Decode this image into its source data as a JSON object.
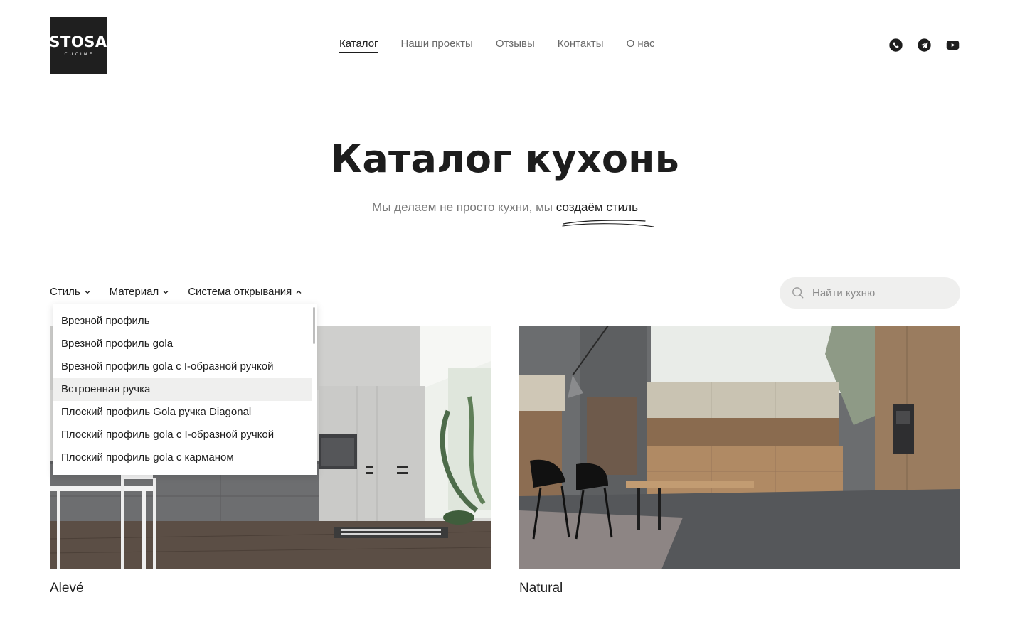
{
  "logo": {
    "main": "STOSA",
    "sub": "CUCINE"
  },
  "nav": {
    "items": [
      {
        "label": "Каталог",
        "active": true
      },
      {
        "label": "Наши проекты",
        "active": false
      },
      {
        "label": "Отзывы",
        "active": false
      },
      {
        "label": "Контакты",
        "active": false
      },
      {
        "label": "О нас",
        "active": false
      }
    ]
  },
  "social": {
    "icons": [
      "whatsapp-icon",
      "telegram-icon",
      "youtube-icon"
    ]
  },
  "hero": {
    "title": "Каталог кухонь",
    "subtitle_lead": "Мы делаем не просто кухни, мы ",
    "subtitle_accent": "создаём стиль"
  },
  "filters": {
    "style": "Стиль",
    "material": "Материал",
    "opening": "Система открывания"
  },
  "search": {
    "placeholder": "Найти кухню"
  },
  "dropdown": {
    "items": [
      "Врезной профиль",
      "Врезной профиль gola",
      "Врезной профиль gola с I-образной ручкой",
      "Встроенная ручка",
      "Плоский профиль Gola ручка Diagonal",
      "Плоский профиль gola с I-образной ручкой",
      "Плоский профиль gola с карманом"
    ],
    "highlighted_index": 3
  },
  "cards": [
    {
      "name": "Alevé"
    },
    {
      "name": "Natural"
    }
  ],
  "colors": {
    "text": "#1d1d1d",
    "muted": "#7a7a7a",
    "search_bg": "#efefee",
    "logo_bg": "#1f1f1f"
  }
}
